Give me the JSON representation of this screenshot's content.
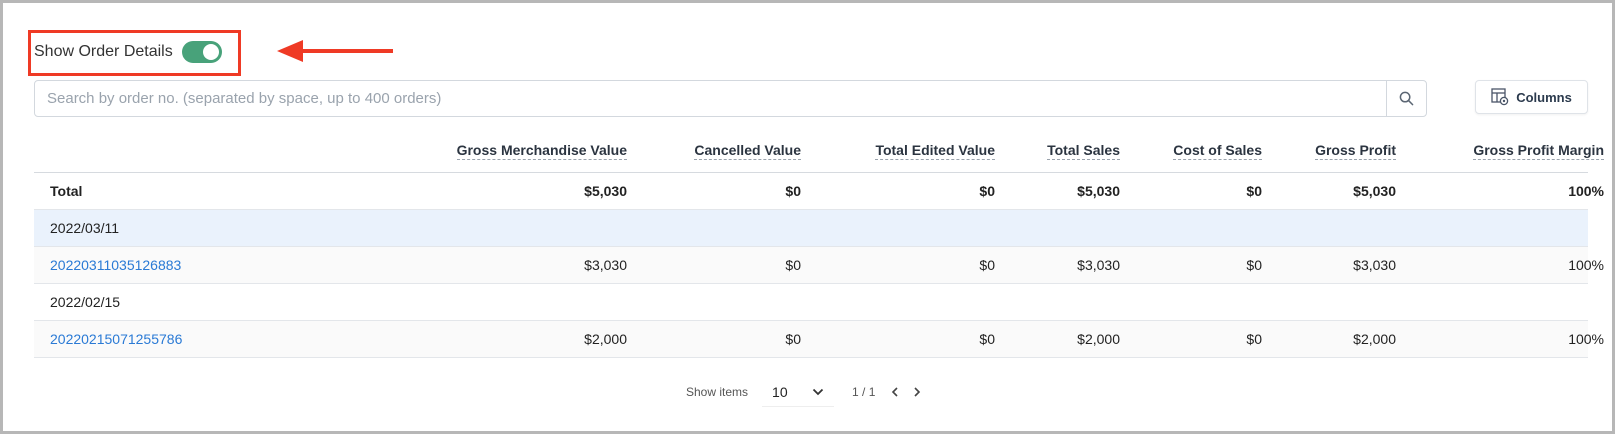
{
  "colors": {
    "toggle_on": "#48a27a",
    "highlight": "#ef3a25",
    "link": "#2a7ad5",
    "date_row_bg": "#eaf2fc"
  },
  "toggle": {
    "label": "Show Order Details",
    "checked": true
  },
  "search": {
    "placeholder": "Search by order no. (separated by space, up to 400 orders)",
    "value": ""
  },
  "columns_button": {
    "label": "Columns",
    "icon": "columns-settings-icon"
  },
  "table": {
    "headers": [
      "Gross Merchandise Value",
      "Cancelled Value",
      "Total Edited Value",
      "Total Sales",
      "Cost of Sales",
      "Gross Profit",
      "Gross Profit Margin"
    ],
    "total": {
      "label": "Total",
      "values": [
        "$5,030",
        "$0",
        "$0",
        "$5,030",
        "$0",
        "$5,030",
        "100%"
      ]
    },
    "groups": [
      {
        "date": "2022/03/11",
        "order": {
          "id": "20220311035126883",
          "values": [
            "$3,030",
            "$0",
            "$0",
            "$3,030",
            "$0",
            "$3,030",
            "100%"
          ]
        }
      },
      {
        "date": "2022/02/15",
        "order": {
          "id": "20220215071255786",
          "values": [
            "$2,000",
            "$0",
            "$0",
            "$2,000",
            "$0",
            "$2,000",
            "100%"
          ]
        }
      }
    ]
  },
  "pagination": {
    "show_items_label": "Show items",
    "page_size": "10",
    "page_info": "1 / 1"
  }
}
